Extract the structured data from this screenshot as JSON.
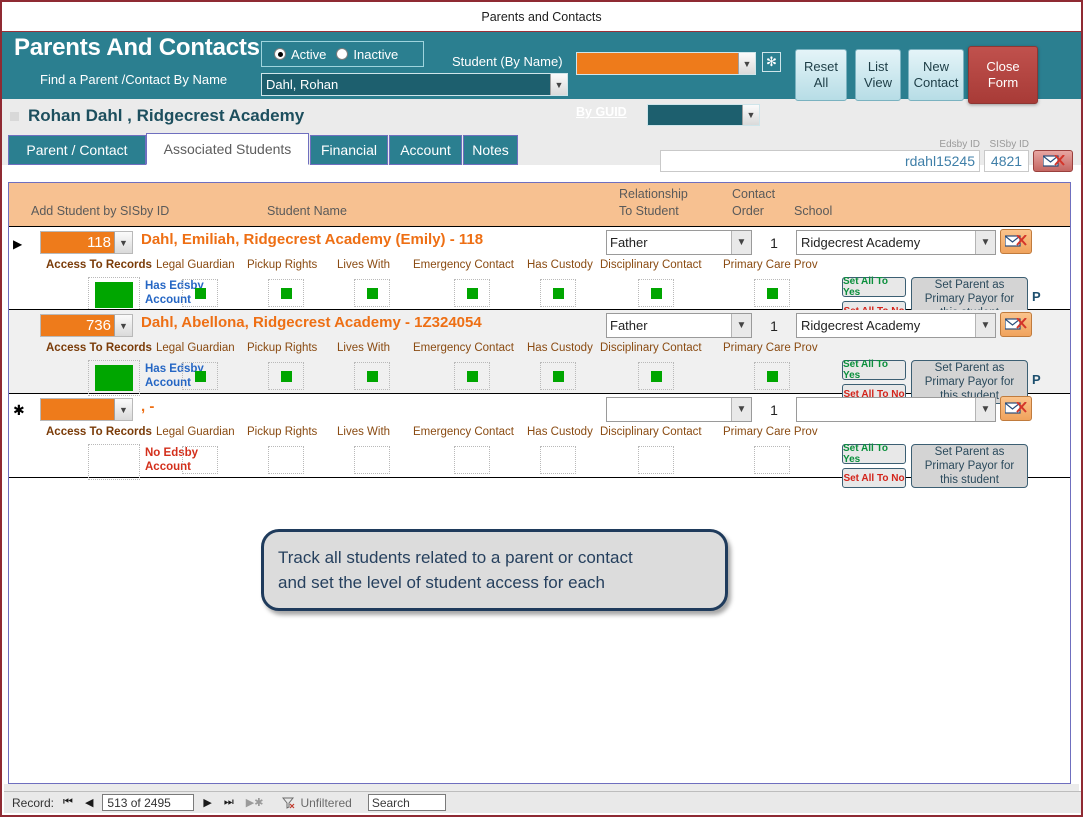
{
  "window": {
    "title": "Parents and Contacts"
  },
  "header": {
    "app_title": "Parents And Contacts",
    "find_label": "Find a Parent /Contact By Name",
    "name_value": "Dahl, Rohan",
    "status_filter": {
      "active_label": "Active",
      "inactive_label": "Inactive",
      "selected": "Active"
    },
    "student_by_name_label": "Student (By Name)",
    "student_by_name_value": "",
    "asterisk_label": "✻",
    "by_guid_label": "By GUID",
    "guid_value": "",
    "buttons": {
      "reset_all": [
        "Reset",
        "All"
      ],
      "list_view": [
        "List",
        "View"
      ],
      "new_contact": [
        "New",
        "Contact"
      ],
      "close_form": [
        "Close",
        "Form"
      ]
    },
    "accent_teal": "#2b7f90",
    "accent_orange": "#ee7b1b",
    "close_red": "#b04a46"
  },
  "record_title": "Rohan  Dahl , Ridgecrest Academy",
  "tabs": [
    {
      "label": "Parent / Contact",
      "active": false
    },
    {
      "label": "Associated Students",
      "active": true
    },
    {
      "label": "Financial",
      "active": false
    },
    {
      "label": "Account",
      "active": false
    },
    {
      "label": "Notes",
      "active": false
    }
  ],
  "ids": {
    "edsby_label": "Edsby ID",
    "sisby_label": "SISby ID",
    "edsby_value": "rdahl15245",
    "sisby_value": "4821"
  },
  "grid": {
    "headers": {
      "add_student": "Add Student by SISby ID",
      "student_name": "Student Name",
      "relationship": [
        "Relationship",
        "To Student"
      ],
      "contact_order": [
        "Contact",
        "Order"
      ],
      "school": "School"
    },
    "flag_labels": [
      "Access To Records",
      "Legal Guardian",
      "Pickup Rights",
      "Lives With",
      "Emergency Contact",
      "Has Custody",
      "Disciplinary Contact",
      "Primary Care Prov"
    ],
    "set_all_yes": "Set All To Yes",
    "set_all_no": "Set All To No",
    "payor_button": [
      "Set Parent as",
      "Primary Payor for",
      "this student"
    ],
    "primary_mark": "P",
    "rows": [
      {
        "selector": "▶",
        "sis_id": "118",
        "student_name": "Dahl, Emiliah, Ridgecrest Academy (Emily)  - 118",
        "relationship": "Father",
        "contact_order": "1",
        "school": "Ridgecrest Academy",
        "edsby_status": "Has Edsby Account",
        "edsby_status_lines": [
          "Has Edsby",
          "Account"
        ],
        "has_edsby": true,
        "access_to_records": true,
        "flags": [
          true,
          true,
          true,
          true,
          true,
          true,
          true
        ],
        "primary_payor": true
      },
      {
        "selector": "",
        "sis_id": "736",
        "student_name": "Dahl, Abellona, Ridgecrest Academy  - 1Z324054",
        "relationship": "Father",
        "contact_order": "1",
        "school": "Ridgecrest Academy",
        "edsby_status": "Has Edsby Account",
        "edsby_status_lines": [
          "Has Edsby",
          "Account"
        ],
        "has_edsby": true,
        "access_to_records": true,
        "flags": [
          true,
          true,
          true,
          true,
          true,
          true,
          true
        ],
        "primary_payor": true
      },
      {
        "selector": "✱",
        "sis_id": "",
        "student_name": ",  -",
        "relationship": "",
        "contact_order": "1",
        "school": "",
        "edsby_status": "No Edsby Account",
        "edsby_status_lines": [
          "No Edsby",
          "Account"
        ],
        "has_edsby": false,
        "access_to_records": false,
        "flags": [
          false,
          false,
          false,
          false,
          false,
          false,
          false
        ],
        "primary_payor": false
      }
    ]
  },
  "callout": {
    "line1": "Track all students related to a parent or contact",
    "line2": "and set the level of student access for each"
  },
  "statusbar": {
    "record_label": "Record:",
    "position": "513 of 2495",
    "filter_label": "Unfiltered",
    "search_value": "Search"
  }
}
